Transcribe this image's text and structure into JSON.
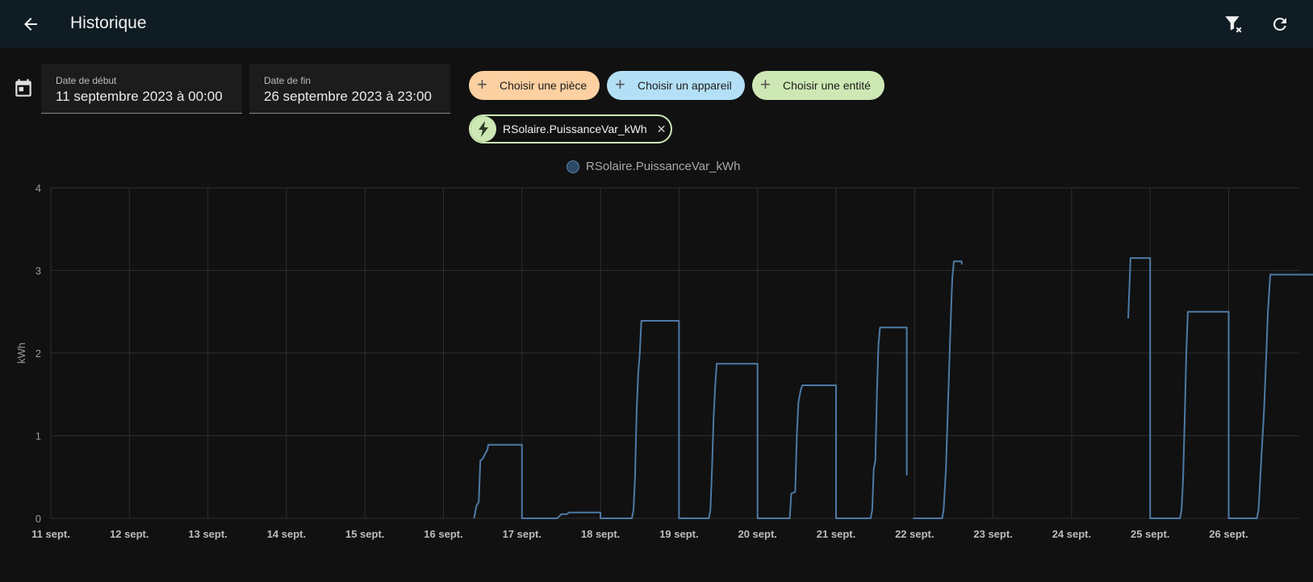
{
  "header": {
    "title": "Historique",
    "back_icon": "arrow-left-icon",
    "filter_clear_icon": "filter-remove-icon",
    "refresh_icon": "refresh-icon"
  },
  "date_range": {
    "start": {
      "label": "Date de début",
      "value": "11 septembre 2023 à 00:00"
    },
    "end": {
      "label": "Date de fin",
      "value": "26 septembre 2023 à 23:00"
    }
  },
  "target_pickers": [
    {
      "label": "Choisir une pièce",
      "color": "#fcd0a1"
    },
    {
      "label": "Choisir un appareil",
      "color": "#b3e0f7"
    },
    {
      "label": "Choisir une entité",
      "color": "#cde8b4"
    }
  ],
  "selected_entity": {
    "name": "RSolaire.PuissanceVar_kWh",
    "icon": "lightning-bolt-icon"
  },
  "chart_data": {
    "type": "line",
    "ylabel": "kWh",
    "ylim": [
      0,
      4
    ],
    "yticks": [
      0,
      1,
      2,
      3,
      4
    ],
    "xlim": [
      0,
      16.96
    ],
    "x_unit": "days since 11 sept.",
    "xticks": [
      {
        "v": 0,
        "label": "11 sept."
      },
      {
        "v": 1,
        "label": "12 sept."
      },
      {
        "v": 2,
        "label": "13 sept."
      },
      {
        "v": 3,
        "label": "14 sept."
      },
      {
        "v": 4,
        "label": "15 sept."
      },
      {
        "v": 5,
        "label": "16 sept."
      },
      {
        "v": 6,
        "label": "17 sept."
      },
      {
        "v": 7,
        "label": "18 sept."
      },
      {
        "v": 8,
        "label": "19 sept."
      },
      {
        "v": 9,
        "label": "20 sept."
      },
      {
        "v": 10,
        "label": "21 sept."
      },
      {
        "v": 11,
        "label": "22 sept."
      },
      {
        "v": 12,
        "label": "23 sept."
      },
      {
        "v": 13,
        "label": "24 sept."
      },
      {
        "v": 14,
        "label": "25 sept."
      },
      {
        "v": 15,
        "label": "26 sept."
      }
    ],
    "grid": true,
    "legend": "top-center",
    "series": [
      {
        "name": "RSolaire.PuissanceVar_kWh",
        "color": "#4e7aa5",
        "segments": [
          [
            [
              5.39,
              0
            ],
            [
              5.42,
              0.15
            ],
            [
              5.45,
              0.2
            ],
            [
              5.47,
              0.7
            ],
            [
              5.5,
              0.72
            ],
            [
              5.53,
              0.78
            ],
            [
              5.56,
              0.83
            ],
            [
              5.57,
              0.89
            ],
            [
              6.0,
              0.89
            ],
            [
              6.0,
              0
            ],
            [
              6.45,
              0
            ],
            [
              6.5,
              0.05
            ],
            [
              6.57,
              0.05
            ],
            [
              6.6,
              0.07
            ],
            [
              7.0,
              0.07
            ],
            [
              7.0,
              0
            ],
            [
              7.4,
              0
            ],
            [
              7.42,
              0.1
            ],
            [
              7.44,
              0.5
            ],
            [
              7.46,
              1.3
            ],
            [
              7.48,
              1.75
            ],
            [
              7.5,
              2.0
            ],
            [
              7.52,
              2.39
            ],
            [
              8.0,
              2.39
            ],
            [
              8.0,
              0
            ],
            [
              8.38,
              0
            ],
            [
              8.4,
              0.1
            ],
            [
              8.42,
              0.6
            ],
            [
              8.44,
              1.2
            ],
            [
              8.46,
              1.6
            ],
            [
              8.48,
              1.87
            ],
            [
              9.0,
              1.87
            ],
            [
              9.0,
              0
            ],
            [
              9.41,
              0
            ],
            [
              9.43,
              0.3
            ],
            [
              9.48,
              0.32
            ],
            [
              9.5,
              1.0
            ],
            [
              9.52,
              1.4
            ],
            [
              9.55,
              1.55
            ],
            [
              9.57,
              1.61
            ],
            [
              10.0,
              1.61
            ],
            [
              10.0,
              0
            ],
            [
              10.44,
              0
            ],
            [
              10.46,
              0.1
            ],
            [
              10.48,
              0.6
            ],
            [
              10.5,
              0.7
            ],
            [
              10.52,
              1.5
            ],
            [
              10.54,
              2.1
            ],
            [
              10.56,
              2.31
            ],
            [
              10.9,
              2.31
            ],
            [
              10.9,
              0.52
            ]
          ],
          [
            [
              10.98,
              0
            ],
            [
              11.35,
              0
            ],
            [
              11.37,
              0.1
            ],
            [
              11.4,
              0.6
            ],
            [
              11.43,
              1.5
            ],
            [
              11.46,
              2.4
            ],
            [
              11.48,
              2.9
            ],
            [
              11.5,
              3.11
            ],
            [
              11.6,
              3.11
            ],
            [
              11.6,
              3.07
            ]
          ],
          [
            [
              13.72,
              2.42
            ],
            [
              13.75,
              3.15
            ],
            [
              14.0,
              3.15
            ],
            [
              14.0,
              0
            ],
            [
              14.38,
              0
            ],
            [
              14.4,
              0.1
            ],
            [
              14.42,
              0.5
            ],
            [
              14.44,
              1.2
            ],
            [
              14.46,
              2.0
            ],
            [
              14.48,
              2.5
            ],
            [
              15.0,
              2.5
            ],
            [
              15.0,
              0
            ],
            [
              15.36,
              0
            ],
            [
              15.38,
              0.1
            ],
            [
              15.42,
              0.8
            ],
            [
              15.45,
              1.3
            ],
            [
              15.48,
              2.0
            ],
            [
              15.5,
              2.5
            ],
            [
              15.53,
              2.95
            ],
            [
              16.96,
              2.95
            ]
          ]
        ]
      }
    ]
  }
}
